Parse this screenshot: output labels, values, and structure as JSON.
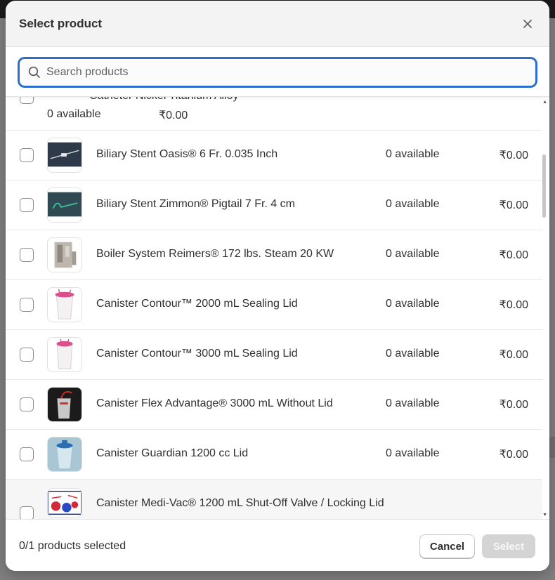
{
  "modal": {
    "title": "Select product"
  },
  "search": {
    "placeholder": "Search products",
    "value": ""
  },
  "partial_row": {
    "name": "Catheter Nickel Titanium Alloy",
    "availability": "0 available",
    "price": "₹0.00"
  },
  "products": [
    {
      "name": "Biliary Stent Oasis® 6 Fr. 0.035 Inch",
      "availability": "0 available",
      "price": "₹0.00",
      "image": "biliary-stent-oasis-image"
    },
    {
      "name": "Biliary Stent Zimmon® Pigtail 7 Fr. 4 cm",
      "availability": "0 available",
      "price": "₹0.00",
      "image": "biliary-stent-zimmon-image"
    },
    {
      "name": "Boiler System Reimers® 172 lbs. Steam 20 KW",
      "availability": "0 available",
      "price": "₹0.00",
      "image": "boiler-system-image"
    },
    {
      "name": "Canister Contour™ 2000 mL Sealing Lid",
      "availability": "0 available",
      "price": "₹0.00",
      "image": "canister-contour-2000-image"
    },
    {
      "name": "Canister Contour™ 3000 mL Sealing Lid",
      "availability": "0 available",
      "price": "₹0.00",
      "image": "canister-contour-3000-image"
    },
    {
      "name": "Canister Flex Advantage® 3000 mL Without Lid",
      "availability": "0 available",
      "price": "₹0.00",
      "image": "canister-flex-advantage-image"
    },
    {
      "name": "Canister Guardian 1200 cc Lid",
      "availability": "0 available",
      "price": "₹0.00",
      "image": "canister-guardian-image"
    },
    {
      "name": "Canister Medi-Vac® 1200 mL Shut-Off Valve / Locking Lid",
      "availability": "",
      "price": "",
      "image": "canister-medi-vac-image"
    }
  ],
  "footer": {
    "selected_count": "0/1 products selected",
    "cancel_label": "Cancel",
    "select_label": "Select"
  },
  "colors": {
    "focus_ring": "#2c6ecb",
    "disabled_button": "#d4d4d4",
    "header_bg": "#f3f3f3"
  },
  "icons": {
    "close": "close-icon",
    "search": "search-icon"
  }
}
